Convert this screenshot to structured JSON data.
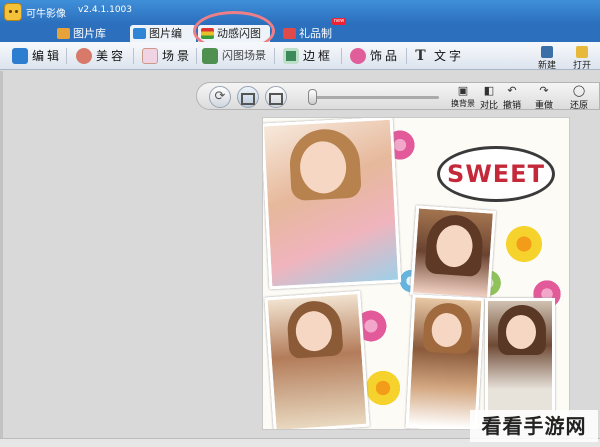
{
  "titlebar": {
    "app_name": "可牛影像",
    "version": "v2.4.1.1003"
  },
  "tabs": [
    {
      "label": "图片库",
      "icon": "photo-library-icon"
    },
    {
      "label": "图片编辑",
      "icon": "photo-edit-icon"
    },
    {
      "label": "动感闪图",
      "icon": "animated-gif-icon"
    },
    {
      "label": "礼品制作",
      "icon": "gift-icon",
      "badge": "new"
    }
  ],
  "toolbar": {
    "tools": [
      {
        "label": "编辑",
        "icon": "edit-icon"
      },
      {
        "label": "美容",
        "icon": "beauty-icon"
      },
      {
        "label": "场景",
        "icon": "scene-icon"
      },
      {
        "label": "闪图场景",
        "icon": "animated-scene-icon"
      },
      {
        "label": "边框",
        "icon": "frame-icon"
      },
      {
        "label": "饰品",
        "icon": "decoration-icon"
      },
      {
        "label": "文字",
        "icon": "text-icon"
      }
    ],
    "new_label": "新建",
    "open_label": "打开"
  },
  "viewbar": {
    "bg_label": "换背景",
    "compare_label": "对比",
    "undo_label": "撤销",
    "redo_label": "重做",
    "restore_label": "还原"
  },
  "canvas": {
    "bubble_text": "SWEET"
  },
  "watermark": "看看手游网",
  "colors": {
    "titlebar": "#2b6fbd",
    "highlight_ring": "#ee7f86",
    "bubble_text": "#c4293a"
  }
}
